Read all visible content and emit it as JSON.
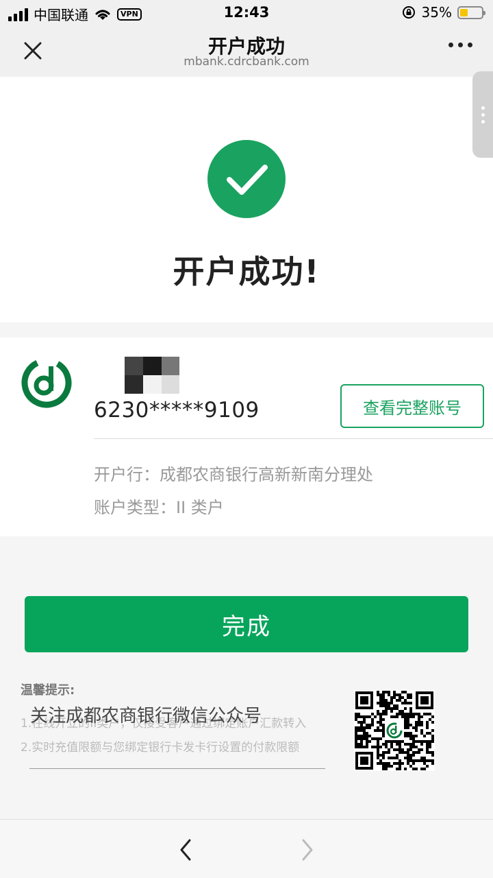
{
  "status_bar": {
    "carrier": "中国联通",
    "vpn": "VPN",
    "time": "12:43",
    "battery": "35%",
    "battery_level": 0.35
  },
  "nav": {
    "title": "开户成功",
    "url": "mbank.cdrcbank.com",
    "close_icon": "close-icon",
    "more_icon": "more-icon"
  },
  "success": {
    "title": "开户成功!"
  },
  "account": {
    "number": "6230*****9109",
    "view_full_label": "查看完整账号",
    "branch": "开户行：成都农商银行高新新南分理处",
    "type": "账户类型：II 类户"
  },
  "done_label": "完成",
  "tips": {
    "title": "温馨提示:",
    "line1": "1.在线开立的II类户，仅接受客户通过绑定账户汇款转入",
    "line2": "2.实时充值限额与您绑定银行卡发卡行设置的付款限额"
  },
  "wechat": {
    "follow_text": "关注成都农商银行微信公众号"
  },
  "colors": {
    "brand_green": "#07a55c",
    "check_green": "#1aa260",
    "logo_green": "#0a7a3e"
  }
}
